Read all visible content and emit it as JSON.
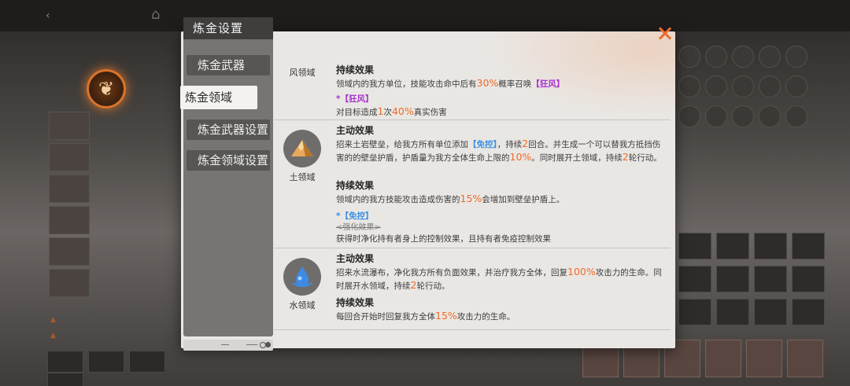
{
  "nav": {
    "title": "炼金设置",
    "items": [
      {
        "label": "炼金武器"
      },
      {
        "label": "炼金领域"
      },
      {
        "label": "炼金武器设置"
      },
      {
        "label": "炼金领域设置"
      }
    ],
    "active_index": 1
  },
  "domains": [
    {
      "name": "风领域",
      "icon": "wind-icon",
      "blocks": [
        {
          "title": "持续效果",
          "text_before": "领域内的我方单位，技能攻击命中后有",
          "highlight": "30%",
          "text_middle": "概率召唤",
          "tag": "【狂风】",
          "text_after": ""
        }
      ],
      "sub": {
        "title": "*【狂风】",
        "text_before": "对目标造成",
        "highlight_1": "1",
        "text_middle": "次",
        "highlight_2": "40%",
        "text_after": "真实伤害"
      }
    },
    {
      "name": "土领域",
      "icon": "mountain-icon",
      "blocks": [
        {
          "title": "主动效果",
          "text_before": "招来土岩壁垒，给我方所有单位添加",
          "tag": "【免控】",
          "text_middle": "，持续",
          "highlight": "2",
          "text_middle2": "回合。并生成一个可以替我方抵挡伤害的的壁垒护盾，护盾量为我方全体生命上限的",
          "highlight_2": "10%",
          "text_middle3": "。同时展开土领域，持续",
          "highlight_3": "2",
          "text_after": "轮行动。"
        },
        {
          "title": "持续效果",
          "text_before": "领域内的我方技能攻击造成伤害的",
          "highlight": "15%",
          "text_after": "会增加到壁垒护盾上。"
        }
      ],
      "sub": {
        "title": "*【免控】",
        "struck": "<强化效果>",
        "text": "获得时净化持有者身上的控制效果，且持有者免疫控制效果"
      }
    },
    {
      "name": "水领域",
      "icon": "water-drop-icon",
      "blocks": [
        {
          "title": "主动效果",
          "text_before": "招来水流瀑布，净化我方所有负面效果，并治疗我方全体，回复",
          "highlight": "100%",
          "text_middle": "攻击力的生命。同时展开水领域，持续",
          "highlight_2": "2",
          "text_after": "轮行动。"
        },
        {
          "title": "持续效果",
          "text_before": "每回合开始时回复我方全体",
          "highlight": "15%",
          "text_after": "攻击力的生命。"
        }
      ]
    }
  ],
  "colors": {
    "highlight": "#ef6a26",
    "tag_purple": "#a734cf",
    "tag_blue": "#3d8fe0",
    "close": "#ee6a2c"
  }
}
